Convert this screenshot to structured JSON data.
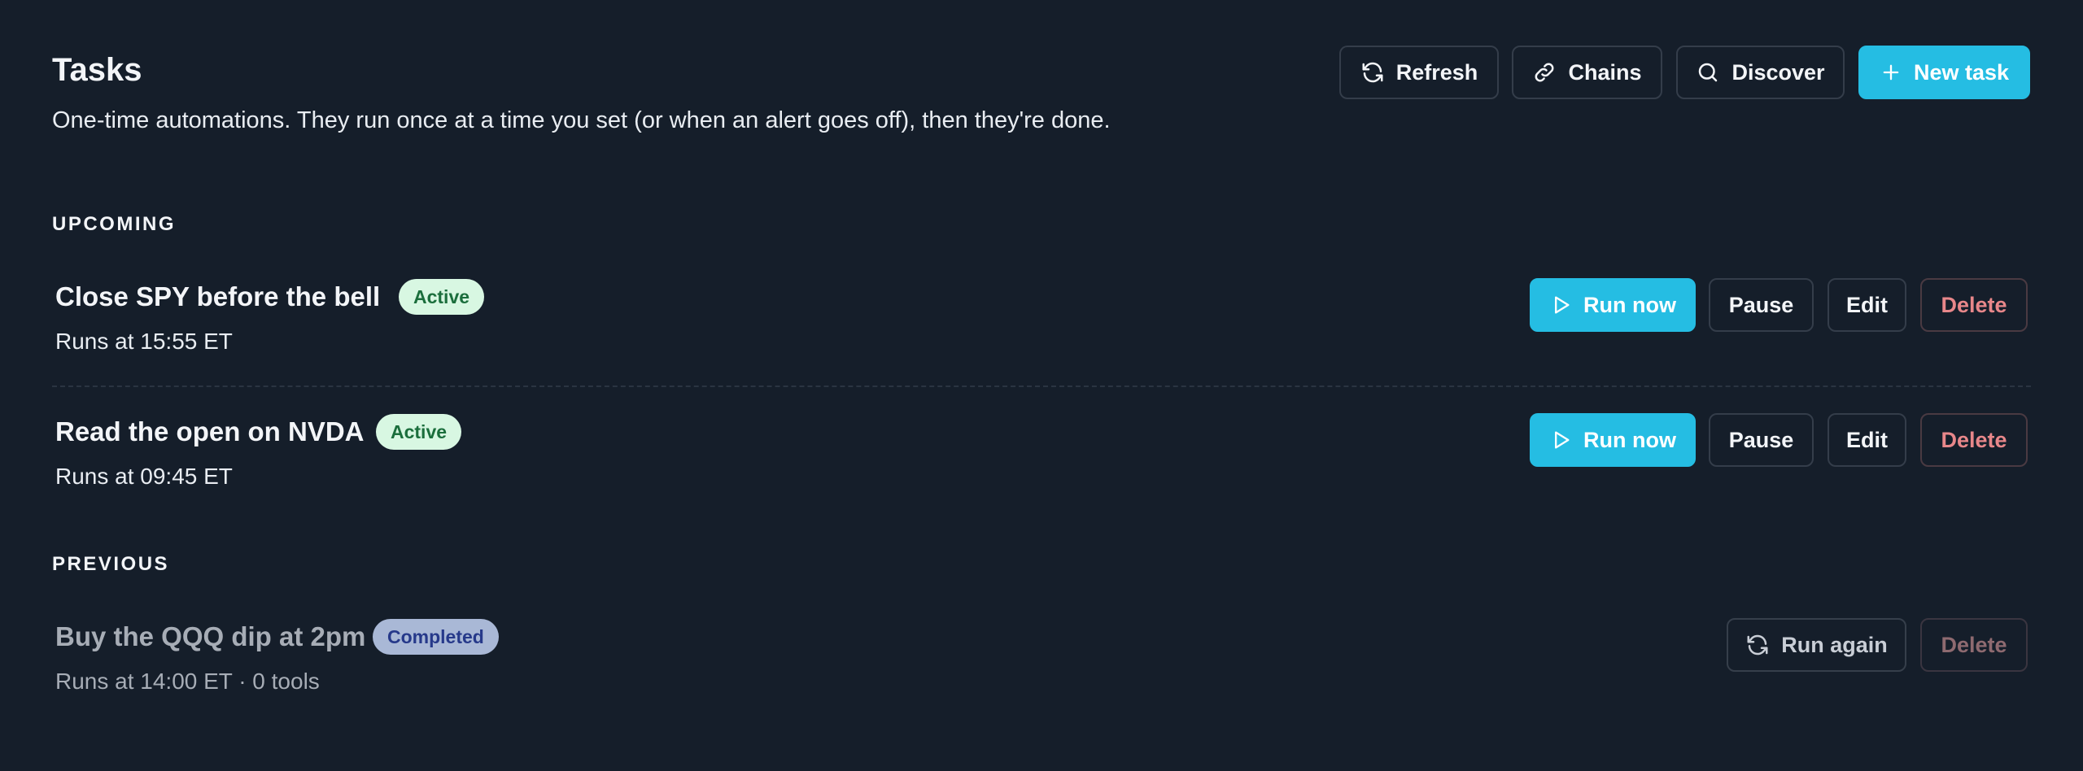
{
  "header": {
    "title": "Tasks",
    "subtitle": "One-time automations. They run once at a time you set (or when an alert goes off), then they're done.",
    "actions": {
      "refresh_label": "Refresh",
      "chains_label": "Chains",
      "discover_label": "Discover",
      "new_task_label": "New task"
    }
  },
  "upcoming": {
    "label": "UPCOMING",
    "tasks": [
      {
        "title": "Close SPY before the bell",
        "status": "Active",
        "schedule": "Runs at 15:55 ET",
        "run_label": "Run now",
        "pause_label": "Pause",
        "edit_label": "Edit",
        "delete_label": "Delete"
      },
      {
        "title": "Read the open on NVDA",
        "status": "Active",
        "schedule": "Runs at 09:45 ET",
        "run_label": "Run now",
        "pause_label": "Pause",
        "edit_label": "Edit",
        "delete_label": "Delete"
      }
    ]
  },
  "previous": {
    "label": "PREVIOUS",
    "tasks": [
      {
        "title": "Buy the QQQ dip at 2pm",
        "status": "Completed",
        "schedule": "Runs at 14:00 ET",
        "tools": "· 0 tools",
        "run_again_label": "Run again",
        "delete_label": "Delete"
      }
    ]
  },
  "colors": {
    "background": "#151e2a",
    "primary": "#25bde3",
    "danger": "#e8878a",
    "active_badge_bg": "#d8f7e2",
    "completed_badge_bg": "#a9b8d6"
  },
  "icons": {
    "refresh": "refresh-icon",
    "chains": "link-icon",
    "discover": "search-icon",
    "new_task": "plus-icon",
    "run_now": "play-icon",
    "run_again": "refresh-icon"
  }
}
